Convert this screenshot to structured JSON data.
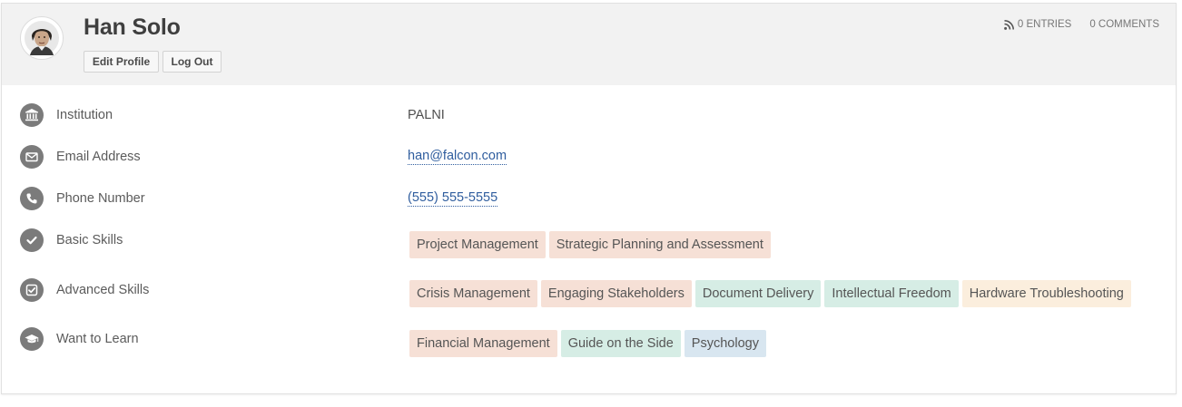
{
  "profile": {
    "name": "Han Solo",
    "edit_label": "Edit Profile",
    "logout_label": "Log Out",
    "avatar_icon": "person-avatar"
  },
  "stats": {
    "entries": "0 Entries",
    "comments": "0 Comments",
    "entries_icon": "rss-icon"
  },
  "fields": {
    "institution": {
      "label": "Institution",
      "value": "PALNI",
      "icon": "institution-icon"
    },
    "email": {
      "label": "Email Address",
      "value": "han@falcon.com",
      "icon": "envelope-icon"
    },
    "phone": {
      "label": "Phone Number",
      "value": "(555) 555-5555",
      "icon": "phone-icon"
    },
    "basic": {
      "label": "Basic Skills",
      "icon": "check-circle-icon"
    },
    "advanced": {
      "label": "Advanced Skills",
      "icon": "check-square-icon"
    },
    "learn": {
      "label": "Want to Learn",
      "icon": "graduation-cap-icon"
    }
  },
  "skills": {
    "basic": [
      {
        "label": "Project Management",
        "color": "#f6e0d6"
      },
      {
        "label": "Strategic Planning and Assessment",
        "color": "#f6e0d6"
      }
    ],
    "advanced": [
      {
        "label": "Crisis Management",
        "color": "#f6e0d6"
      },
      {
        "label": "Engaging Stakeholders",
        "color": "#f6e0d6"
      },
      {
        "label": "Document Delivery",
        "color": "#d6ede5"
      },
      {
        "label": "Intellectual Freedom",
        "color": "#d6ede5"
      },
      {
        "label": "Hardware Troubleshooting",
        "color": "#fbeedd"
      }
    ],
    "learn": [
      {
        "label": "Financial Management",
        "color": "#f6e0d6"
      },
      {
        "label": "Guide on the Side",
        "color": "#d6ede5"
      },
      {
        "label": "Psychology",
        "color": "#d8e6f0"
      }
    ]
  }
}
